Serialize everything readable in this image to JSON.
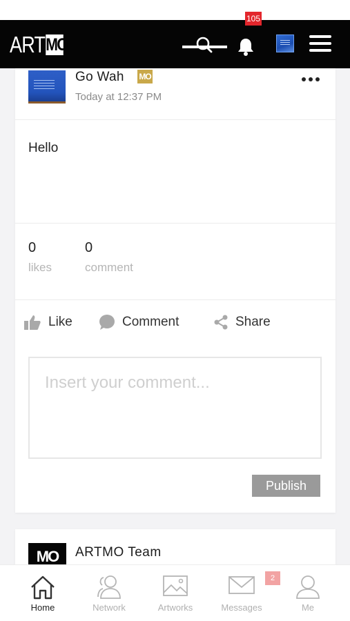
{
  "header": {
    "logo_text_a": "ART",
    "logo_text_b": "MO",
    "notification_count": "105",
    "icons": [
      "search-icon",
      "bell-icon",
      "profile-avatar",
      "hamburger-menu-icon"
    ]
  },
  "post": {
    "author": "Go Wah",
    "author_badge": "MO",
    "time": "Today at 12:37 PM",
    "text": "Hello",
    "likes_count": "0",
    "likes_label": "likes",
    "comments_count": "0",
    "comments_label": "comment",
    "actions": {
      "like": "Like",
      "comment": "Comment",
      "share": "Share"
    },
    "comment_placeholder": "Insert your comment...",
    "publish_label": "Publish"
  },
  "next_post": {
    "logo": "MO",
    "author": "ARTMO Team"
  },
  "bottom_nav": {
    "tabs": [
      {
        "label": "Home",
        "icon": "home-icon",
        "active": true
      },
      {
        "label": "Network",
        "icon": "network-icon",
        "active": false
      },
      {
        "label": "Artworks",
        "icon": "artworks-icon",
        "active": false
      },
      {
        "label": "Messages",
        "icon": "messages-icon",
        "active": false
      },
      {
        "label": "Me",
        "icon": "me-icon",
        "active": false
      }
    ],
    "messages_badge": "2"
  },
  "colors": {
    "topbar": "#050505",
    "notification_badge": "#e3262c",
    "mo_badge": "#c9a84a",
    "publish_button": "#9a9a9a",
    "messages_badge": "#f2a3a3"
  }
}
